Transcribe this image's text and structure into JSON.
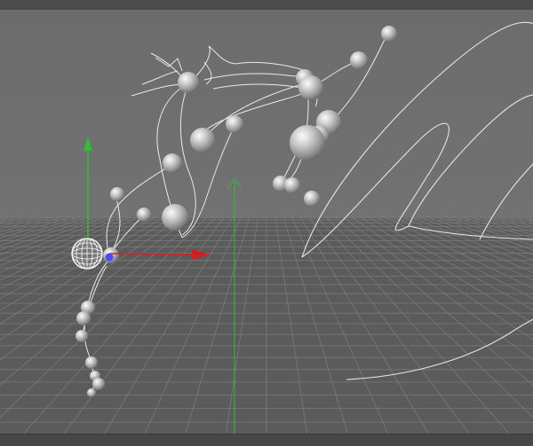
{
  "viewport": {
    "view": "perspective",
    "colors": {
      "sky": "#6e6e6e",
      "floor": "#5c5c5c",
      "grid_line": "#7a7a7a",
      "horizon": "#5d6b8a",
      "axis_x": "#d22020",
      "axis_y": "#2fbf2f",
      "axis_z": "#4b4bff",
      "spline": "#e6e6e6"
    },
    "icons": [
      "scene-axis-gizmo-icon",
      "world-axis-icon",
      "wireframe-null-object-icon"
    ]
  }
}
